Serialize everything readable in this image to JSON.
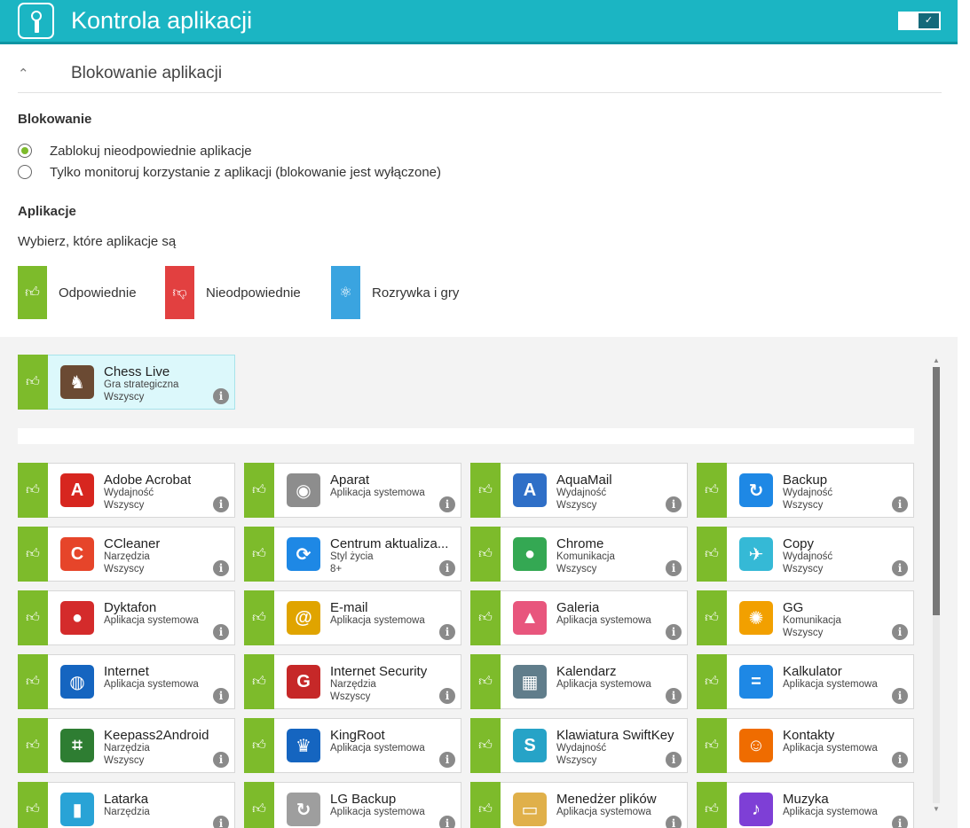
{
  "header": {
    "title": "Kontrola aplikacji",
    "toggle_check": "✓"
  },
  "section": {
    "title": "Blokowanie aplikacji"
  },
  "blocking": {
    "label": "Blokowanie",
    "options": [
      {
        "text": "Zablokuj nieodpowiednie aplikacje",
        "selected": true
      },
      {
        "text": "Tylko monitoruj korzystanie z aplikacji (blokowanie jest wyłączone)",
        "selected": false
      }
    ]
  },
  "apps_section": {
    "label": "Aplikacje",
    "subtitle": "Wybierz, które aplikacje są",
    "legend": [
      {
        "text": "Odpowiednie",
        "color": "#7dbb2b"
      },
      {
        "text": "Nieodpowiednie",
        "color": "#e24040"
      },
      {
        "text": "Rozrywka i gry",
        "color": "#3aa4e0"
      }
    ]
  },
  "featured": {
    "name": "Chess Live",
    "category": "Gra strategiczna",
    "age": "Wszyscy"
  },
  "apps": [
    {
      "name": "Adobe Acrobat",
      "category": "Wydajność",
      "age": "Wszyscy",
      "icon": "A",
      "color": "#d7261f"
    },
    {
      "name": "Aparat",
      "category": "Aplikacja systemowa",
      "age": "",
      "icon": "◉",
      "color": "#8d8d8d"
    },
    {
      "name": "AquaMail",
      "category": "Wydajność",
      "age": "Wszyscy",
      "icon": "A",
      "color": "#2f6fc7"
    },
    {
      "name": "Backup",
      "category": "Wydajność",
      "age": "Wszyscy",
      "icon": "↻",
      "color": "#1e88e5"
    },
    {
      "name": "CCleaner",
      "category": "Narzędzia",
      "age": "Wszyscy",
      "icon": "C",
      "color": "#e6452a"
    },
    {
      "name": "Centrum aktualiza...",
      "category": "Styl życia",
      "age": "8+",
      "icon": "⟳",
      "color": "#1e88e5"
    },
    {
      "name": "Chrome",
      "category": "Komunikacja",
      "age": "Wszyscy",
      "icon": "●",
      "color": "#34a853"
    },
    {
      "name": "Copy",
      "category": "Wydajność",
      "age": "Wszyscy",
      "icon": "✈",
      "color": "#35b9d6"
    },
    {
      "name": "Dyktafon",
      "category": "Aplikacja systemowa",
      "age": "",
      "icon": "●",
      "color": "#d42b2b"
    },
    {
      "name": "E-mail",
      "category": "Aplikacja systemowa",
      "age": "",
      "icon": "@",
      "color": "#e0a400"
    },
    {
      "name": "Galeria",
      "category": "Aplikacja systemowa",
      "age": "",
      "icon": "▲",
      "color": "#e8567d"
    },
    {
      "name": "GG",
      "category": "Komunikacja",
      "age": "Wszyscy",
      "icon": "✺",
      "color": "#f2a000"
    },
    {
      "name": "Internet",
      "category": "Aplikacja systemowa",
      "age": "",
      "icon": "◍",
      "color": "#1565c0"
    },
    {
      "name": "Internet Security",
      "category": "Narzędzia",
      "age": "Wszyscy",
      "icon": "G",
      "color": "#c62828"
    },
    {
      "name": "Kalendarz",
      "category": "Aplikacja systemowa",
      "age": "",
      "icon": "▦",
      "color": "#607d8b"
    },
    {
      "name": "Kalkulator",
      "category": "Aplikacja systemowa",
      "age": "",
      "icon": "=",
      "color": "#1e88e5"
    },
    {
      "name": "Keepass2Android",
      "category": "Narzędzia",
      "age": "Wszyscy",
      "icon": "⌗",
      "color": "#2e7d32"
    },
    {
      "name": "KingRoot",
      "category": "Aplikacja systemowa",
      "age": "",
      "icon": "♛",
      "color": "#1565c0"
    },
    {
      "name": "Klawiatura SwiftKey",
      "category": "Wydajność",
      "age": "Wszyscy",
      "icon": "S",
      "color": "#26a3c7"
    },
    {
      "name": "Kontakty",
      "category": "Aplikacja systemowa",
      "age": "",
      "icon": "☺",
      "color": "#ef6c00"
    },
    {
      "name": "Latarka",
      "category": "Narzędzia",
      "age": "",
      "icon": "▮",
      "color": "#29a3d6"
    },
    {
      "name": "LG Backup",
      "category": "Aplikacja systemowa",
      "age": "",
      "icon": "↻",
      "color": "#9e9e9e"
    },
    {
      "name": "Menedżer plików",
      "category": "Aplikacja systemowa",
      "age": "",
      "icon": "▭",
      "color": "#e0b04a"
    },
    {
      "name": "Muzyka",
      "category": "Aplikacja systemowa",
      "age": "",
      "icon": "♪",
      "color": "#7e3fd6"
    }
  ]
}
